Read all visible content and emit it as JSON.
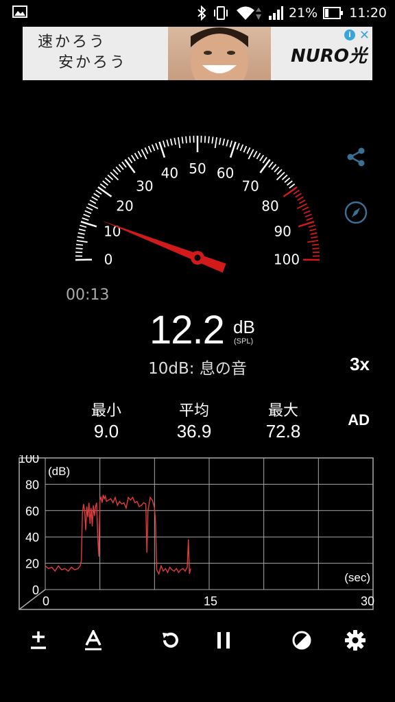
{
  "status_bar": {
    "battery": "21%",
    "time": "11:20"
  },
  "ad": {
    "line1": "速かろう",
    "line2": "安かろう",
    "brand": "NURO光",
    "info": "i",
    "close": "✕"
  },
  "gauge": {
    "ticks": [
      "0",
      "10",
      "20",
      "30",
      "40",
      "50",
      "60",
      "70",
      "80",
      "90",
      "100"
    ],
    "needle_value_db": 12.2,
    "red_zone_from_db": 80,
    "needle_color": "#d21a1a",
    "red_zone_color": "#d21a1a"
  },
  "timer": "00:13",
  "reading": {
    "value": "12.2",
    "unit": "dB",
    "unit_sub": "(SPL)",
    "description": "10dB: 息の音",
    "multiplier": "3x"
  },
  "stats": {
    "min_label": "最小",
    "min_value": "9.0",
    "avg_label": "平均",
    "avg_value": "36.9",
    "max_label": "最大",
    "max_value": "72.8",
    "ad_label": "AD"
  },
  "chart_data": {
    "type": "line",
    "y_unit_label": "(dB)",
    "x_unit_label": "(sec)",
    "y_ticks": [
      "100",
      "80",
      "60",
      "40",
      "20",
      "0"
    ],
    "x_ticks": [
      "0",
      "15",
      "30"
    ],
    "xlim": [
      0,
      30
    ],
    "ylim": [
      0,
      100
    ],
    "grid": true,
    "series": [
      {
        "color": "#e23c3c",
        "x": [
          0,
          0.3,
          0.6,
          0.9,
          1.2,
          1.5,
          1.8,
          2.1,
          2.4,
          2.7,
          3.0,
          3.2,
          3.3,
          3.4,
          3.5,
          3.6,
          3.7,
          3.8,
          3.9,
          4.0,
          4.1,
          4.2,
          4.3,
          4.4,
          4.5,
          4.6,
          4.7,
          4.8,
          4.9,
          5.0,
          5.1,
          5.2,
          5.3,
          5.4,
          5.5,
          5.6,
          5.8,
          6.0,
          6.2,
          6.4,
          6.6,
          6.8,
          7.0,
          7.2,
          7.4,
          7.6,
          7.8,
          8.0,
          8.2,
          8.4,
          8.6,
          8.8,
          9.0,
          9.2,
          9.3,
          9.4,
          9.6,
          9.8,
          10.0,
          10.1,
          10.2,
          10.4,
          10.6,
          10.8,
          11.0,
          11.2,
          11.4,
          11.6,
          11.8,
          12.0,
          12.2,
          12.4,
          12.6,
          12.8,
          13.0,
          13.1,
          13.2,
          13.3
        ],
        "y": [
          18,
          16,
          17,
          14,
          18,
          15,
          16,
          14,
          17,
          15,
          16,
          18,
          22,
          58,
          65,
          60,
          45,
          63,
          55,
          66,
          50,
          62,
          48,
          64,
          56,
          63,
          66,
          40,
          25,
          68,
          70,
          66,
          72,
          69,
          71,
          67,
          68,
          69,
          66,
          70,
          64,
          67,
          65,
          66,
          62,
          70,
          68,
          70,
          66,
          67,
          63,
          64,
          66,
          65,
          28,
          60,
          70,
          68,
          62,
          50,
          15,
          12,
          18,
          14,
          16,
          13,
          17,
          15,
          14,
          16,
          13,
          15,
          16,
          14,
          17,
          38,
          12,
          16
        ]
      }
    ]
  }
}
